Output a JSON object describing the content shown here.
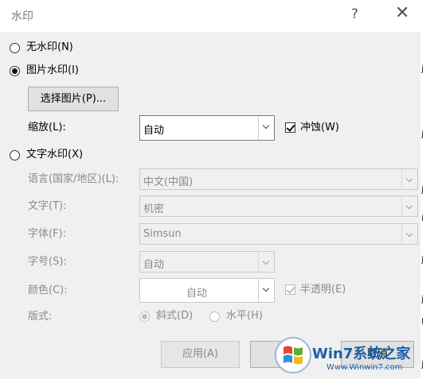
{
  "window": {
    "title": "水印",
    "help_glyph": "?",
    "close_glyph": "✕"
  },
  "options": {
    "none": {
      "label": "无水印(N)",
      "checked": false
    },
    "picture": {
      "label": "图片水印(I)",
      "checked": true
    },
    "text": {
      "label": "文字水印(X)",
      "checked": false
    }
  },
  "picture": {
    "select_button": "选择图片(P)...",
    "scale_label": "缩放(L):",
    "scale_value": "自动",
    "washout_label": "冲蚀(W)",
    "washout_checked": true
  },
  "text": {
    "language_label": "语言(国家/地区)(L):",
    "language_value": "中文(中国)",
    "text_label": "文字(T):",
    "text_value": "机密",
    "font_label": "字体(F):",
    "font_value": "Simsun",
    "size_label": "字号(S):",
    "size_value": "自动",
    "color_label": "颜色(C):",
    "color_value": "自动",
    "semitransparent_label": "半透明(E)",
    "semitransparent_checked": true,
    "layout_label": "版式:",
    "diagonal_label": "斜式(D)",
    "horizontal_label": "水平(H)"
  },
  "buttons": {
    "apply": "应用(A)",
    "cancel": "取消"
  },
  "watermark": {
    "text": "Win7系统之家",
    "url": "Www.Winwin7.com"
  },
  "edge_chars": [
    "j",
    "j",
    "j",
    "i",
    "j",
    "j",
    "l",
    "j"
  ]
}
